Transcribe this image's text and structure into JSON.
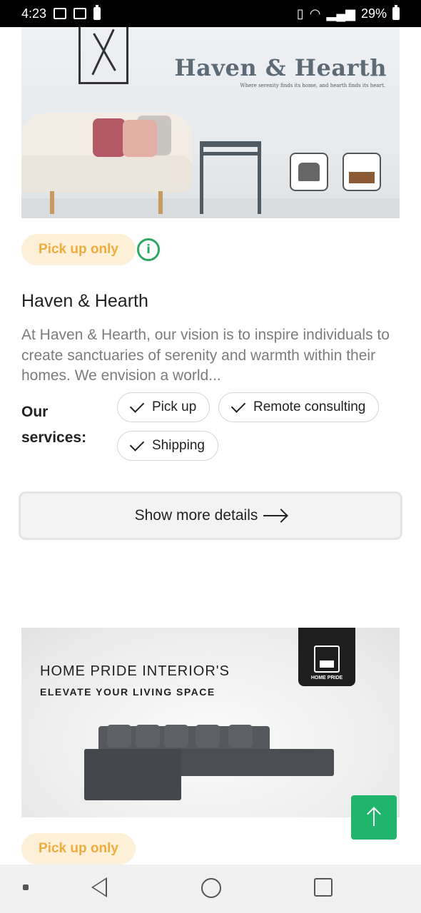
{
  "status_bar": {
    "time": "4:23",
    "battery": "29%"
  },
  "card1": {
    "banner_title": "Haven & Hearth",
    "banner_tagline": "Where serenity finds its home, and hearth finds its heart.",
    "badge": "Pick up only",
    "title": "Haven & Hearth",
    "description": "At Haven & Hearth, our vision is to inspire individuals to create sanctuaries of serenity and warmth within their homes. We envision a world...",
    "services_label": "Our services:",
    "services": [
      "Pick up",
      "Remote consulting",
      "Shipping"
    ],
    "details_button": "Show more details"
  },
  "card2": {
    "banner_title": "HOME PRIDE INTERIOR'S",
    "banner_tagline": "ELEVATE YOUR LIVING SPACE",
    "logo_text": "HOME PRIDE",
    "badge": "Pick up only"
  },
  "colors": {
    "accent_green": "#1fb56a",
    "badge_text": "#f0ad3a",
    "badge_bg": "#fdf0d9"
  }
}
